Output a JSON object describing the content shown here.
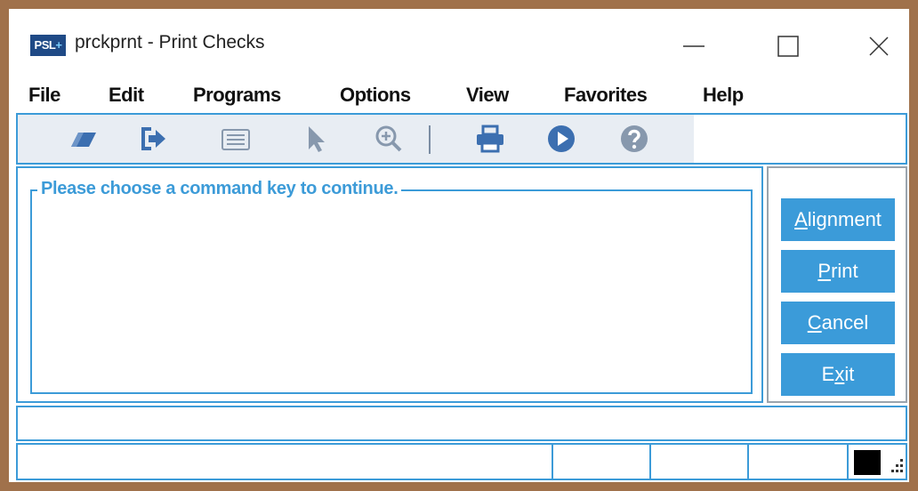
{
  "window": {
    "app_icon_text": "PSL",
    "app_icon_plus": "+",
    "title": "prckprnt - Print Checks"
  },
  "menu": {
    "items": [
      "File",
      "Edit",
      "Programs",
      "Options",
      "View",
      "Favorites",
      "Help"
    ]
  },
  "toolbar": {
    "icons": [
      "eraser-icon",
      "exit-arrow-icon",
      "list-icon",
      "pointer-icon",
      "zoom-in-icon",
      "printer-icon",
      "play-icon",
      "help-icon"
    ]
  },
  "main": {
    "prompt": "Please choose a command key to continue."
  },
  "commands": {
    "alignment": {
      "hotkey": "A",
      "rest": "lignment"
    },
    "print": {
      "hotkey": "P",
      "rest": "rint"
    },
    "cancel": {
      "hotkey": "C",
      "rest": "ancel"
    },
    "exit": {
      "pre": "E",
      "hotkey": "x",
      "rest": "it"
    }
  },
  "colors": {
    "accent": "#3b9bd9",
    "frame": "#a0714b",
    "toolbar_bg": "#e8edf3",
    "icon": "#3c6fb0"
  }
}
